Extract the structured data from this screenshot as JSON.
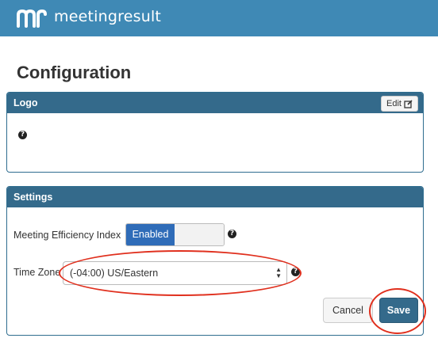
{
  "header": {
    "brand_name": "meetingresult",
    "brand_color": "#3f89b5"
  },
  "page": {
    "title": "Configuration"
  },
  "logo_panel": {
    "title": "Logo",
    "edit_label": "Edit"
  },
  "settings_panel": {
    "title": "Settings",
    "mei_label": "Meeting Efficiency Index",
    "mei_state": "Enabled",
    "timezone_label": "Time Zone",
    "timezone_value": "(-04:00) US/Eastern",
    "cancel_label": "Cancel",
    "save_label": "Save"
  },
  "icons": {
    "help": "?",
    "edit": "edit-icon"
  },
  "colors": {
    "panel_header": "#346a8b",
    "toggle_on": "#2f6cb8",
    "annotation": "#e0301e"
  }
}
